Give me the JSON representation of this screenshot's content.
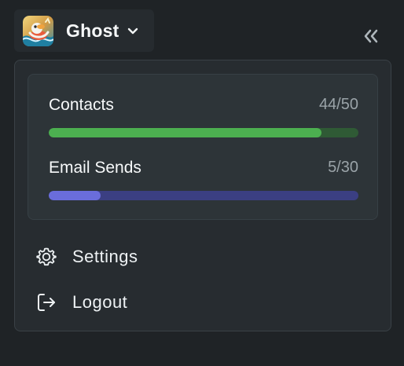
{
  "workspace": {
    "name": "Ghost",
    "logo_icon": "ghost-duck-logo-icon"
  },
  "header": {
    "collapse_icon": "double-chevron-left-icon"
  },
  "usage": {
    "items": [
      {
        "label": "Contacts",
        "count_text": "44/50",
        "used": 44,
        "limit": 50,
        "fill_color": "#4caf50",
        "track_color": "#2f5a35"
      },
      {
        "label": "Email Sends",
        "count_text": "5/30",
        "used": 5,
        "limit": 30,
        "fill_color": "#6a6ddb",
        "track_color": "#3b3f82"
      }
    ]
  },
  "menu": {
    "items": [
      {
        "label": "Settings",
        "icon": "gear-icon"
      },
      {
        "label": "Logout",
        "icon": "logout-icon"
      }
    ]
  },
  "colors": {
    "background": "#1f2326",
    "panel": "#272c30",
    "card": "#2d3438",
    "text": "#f3f5f6",
    "muted": "#9aa3a8"
  }
}
